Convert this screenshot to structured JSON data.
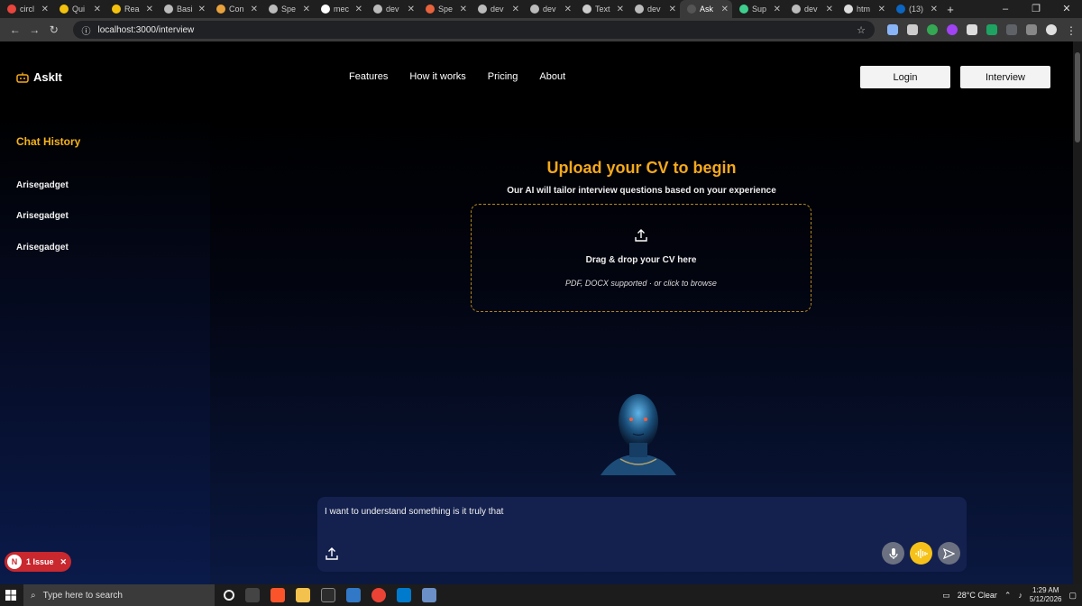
{
  "browser": {
    "tabs": [
      {
        "label": "circl",
        "color": "#e8453c"
      },
      {
        "label": "Qui",
        "color": "#f4c20d"
      },
      {
        "label": "Rea",
        "color": "#f4c20d"
      },
      {
        "label": "Basi",
        "color": "#bbbbbb"
      },
      {
        "label": "Con",
        "color": "#e8a23c"
      },
      {
        "label": "Spe",
        "color": "#bbbbbb"
      },
      {
        "label": "mec",
        "color": "#ffffff"
      },
      {
        "label": "dev",
        "color": "#bbbbbb"
      },
      {
        "label": "Spe",
        "color": "#e8633c"
      },
      {
        "label": "dev",
        "color": "#bbbbbb"
      },
      {
        "label": "dev",
        "color": "#bbbbbb"
      },
      {
        "label": "Text",
        "color": "#cccccc"
      },
      {
        "label": "dev",
        "color": "#bbbbbb"
      },
      {
        "label": "Ask",
        "color": "#555555"
      },
      {
        "label": "Sup",
        "color": "#3ecf8e"
      },
      {
        "label": "dev",
        "color": "#bbbbbb"
      },
      {
        "label": "htm",
        "color": "#dddddd"
      },
      {
        "label": "(13)",
        "color": "#0a66c2"
      }
    ],
    "url": "localhost:3000/interview"
  },
  "nav": {
    "brand": "AskIt",
    "menu": [
      "Features",
      "How it works",
      "Pricing",
      "About"
    ],
    "login": "Login",
    "interview": "Interview"
  },
  "sidebar": {
    "title": "Chat History",
    "items": [
      "Arisegadget",
      "Arisegadget",
      "Arisegadget"
    ]
  },
  "main": {
    "headline": "Upload your CV to begin",
    "subline": "Our AI will tailor interview questions based on your experience",
    "dropzone_title": "Drag & drop your CV here",
    "dropzone_sub": "PDF, DOCX supported · or click to browse"
  },
  "chat": {
    "input_text": "I want to understand something  is it truly that"
  },
  "devtools": {
    "badge_letter": "N",
    "issue_label": "1 Issue"
  },
  "taskbar": {
    "search_placeholder": "Type here to search",
    "weather": "28°C  Clear",
    "time": "1:29 AM",
    "date": "5/12/2026"
  },
  "colors": {
    "accent": "#f5a91c",
    "chatbox": "#14214f",
    "issue": "#c8282e"
  }
}
